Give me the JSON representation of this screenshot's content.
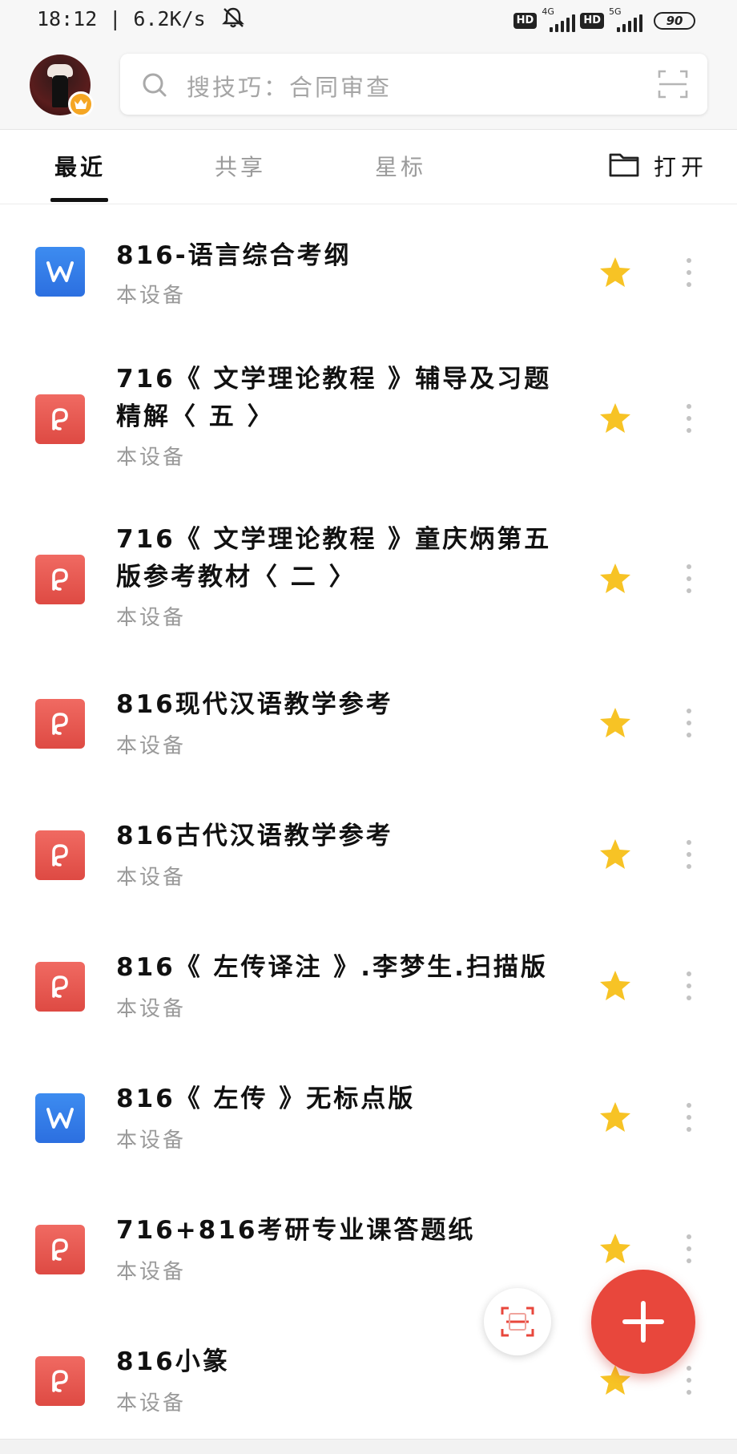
{
  "status_bar": {
    "time_speed": "18:12 | 6.2K/s",
    "hd1": "HD",
    "net1": "4G",
    "hd2": "HD",
    "net2": "5G",
    "battery": "90"
  },
  "search": {
    "placeholder": "搜技巧：合同审查"
  },
  "tabs": [
    {
      "label": "最近",
      "active": true
    },
    {
      "label": "共享",
      "active": false
    },
    {
      "label": "星标",
      "active": false
    }
  ],
  "open_label": "打开",
  "files": [
    {
      "title": "816-语言综合考纲",
      "title2": "",
      "location": "本设备",
      "type": "word-icon",
      "starred": true
    },
    {
      "title": "716《 文学理论教程 》辅导及习题",
      "title2": "精解〈 五 〉",
      "location": "本设备",
      "type": "pdf-icon",
      "starred": true
    },
    {
      "title": "716《 文学理论教程 》童庆炳第五",
      "title2": "版参考教材〈 二 〉",
      "location": "本设备",
      "type": "pdf-icon",
      "starred": true
    },
    {
      "title": "816现代汉语教学参考",
      "title2": "",
      "location": "本设备",
      "type": "pdf-icon",
      "starred": true
    },
    {
      "title": "816古代汉语教学参考",
      "title2": "",
      "location": "本设备",
      "type": "pdf-icon",
      "starred": true
    },
    {
      "title": "816《 左传译注 》.李梦生.扫描版",
      "title2": "",
      "location": "本设备",
      "type": "pdf-icon",
      "starred": true
    },
    {
      "title": "816《 左传 》无标点版",
      "title2": "",
      "location": "本设备",
      "type": "word-icon",
      "starred": true
    },
    {
      "title": "716+816考研专业课答题纸",
      "title2": "",
      "location": "本设备",
      "type": "pdf-icon",
      "starred": true
    },
    {
      "title": "816小篆",
      "title2": "",
      "location": "本设备",
      "type": "pdf-icon",
      "starred": true
    }
  ],
  "colors": {
    "accent_red": "#e8473c",
    "star_yellow": "#f7c325",
    "word_blue": "#2c6fe0",
    "pdf_red": "#de4a43"
  }
}
